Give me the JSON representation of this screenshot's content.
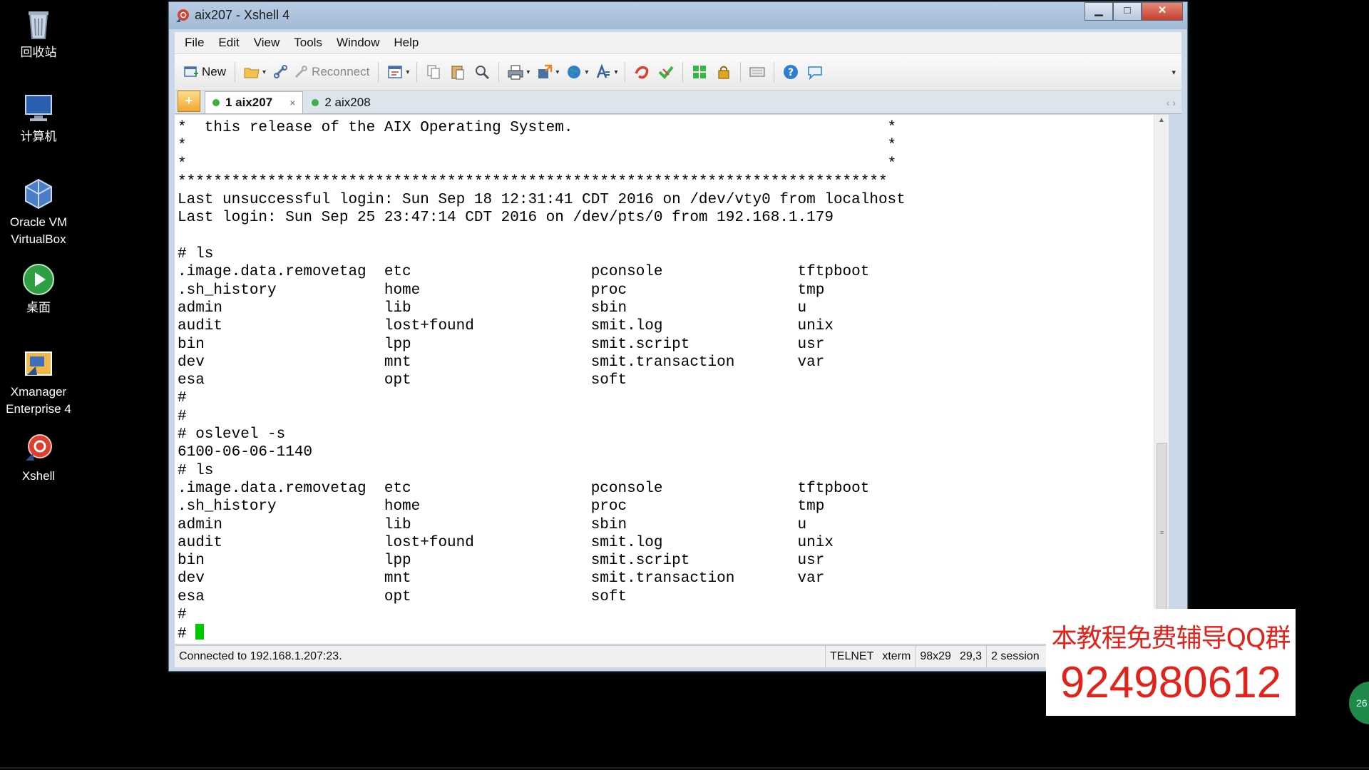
{
  "desktop": {
    "icons": [
      {
        "name": "recycle-bin",
        "label": "回收站"
      },
      {
        "name": "computer",
        "label": "计算机"
      },
      {
        "name": "oracle-vm",
        "label": "Oracle VM\nVirtualBox"
      },
      {
        "name": "desktop-shortcut",
        "label": "桌面"
      },
      {
        "name": "xmanager",
        "label": "Xmanager\nEnterprise 4"
      },
      {
        "name": "xshell",
        "label": "Xshell"
      }
    ]
  },
  "window": {
    "title": "aix207 - Xshell 4",
    "controls": {
      "minimize": "▁",
      "maximize": "□",
      "close": "✕"
    }
  },
  "menu": [
    "File",
    "Edit",
    "View",
    "Tools",
    "Window",
    "Help"
  ],
  "toolbar": {
    "new_label": "New",
    "reconnect_label": "Reconnect"
  },
  "tabs": {
    "add_symbol": "+",
    "items": [
      {
        "label": "1 aix207",
        "active": true,
        "close": "×"
      },
      {
        "label": "2 aix208",
        "active": false
      }
    ],
    "arrows": "‹ ›"
  },
  "terminal": {
    "lines": [
      "*  this release of the AIX Operating System.                                   *",
      "*                                                                              *",
      "*                                                                              *",
      "*******************************************************************************",
      "Last unsuccessful login: Sun Sep 18 12:31:41 CDT 2016 on /dev/vty0 from localhost",
      "Last login: Sun Sep 25 23:47:14 CDT 2016 on /dev/pts/0 from 192.168.1.179",
      "",
      "# ls",
      ".image.data.removetag  etc                    pconsole               tftpboot",
      ".sh_history            home                   proc                   tmp",
      "admin                  lib                    sbin                   u",
      "audit                  lost+found             smit.log               unix",
      "bin                    lpp                    smit.script            usr",
      "dev                    mnt                    smit.transaction       var",
      "esa                    opt                    soft",
      "#",
      "#",
      "# oslevel -s",
      "6100-06-06-1140",
      "# ls",
      ".image.data.removetag  etc                    pconsole               tftpboot",
      ".sh_history            home                   proc                   tmp",
      "admin                  lib                    sbin                   u",
      "audit                  lost+found             smit.log               unix",
      "bin                    lpp                    smit.script            usr",
      "dev                    mnt                    smit.transaction       var",
      "esa                    opt                    soft",
      "#",
      "# "
    ]
  },
  "status": {
    "connection": "Connected to 192.168.1.207:23.",
    "protocol": "TELNET",
    "term": "xterm",
    "size": "98x29",
    "cursor_pos": "29,3",
    "sessions": "2 session"
  },
  "promo": {
    "line1": "本教程免费辅导QQ群",
    "line2": "924980612"
  },
  "edge_badge": "26",
  "colors": {
    "cursor": "#00c800",
    "promo_text": "#e3231b",
    "tab_status_dot": "#3cb043"
  }
}
